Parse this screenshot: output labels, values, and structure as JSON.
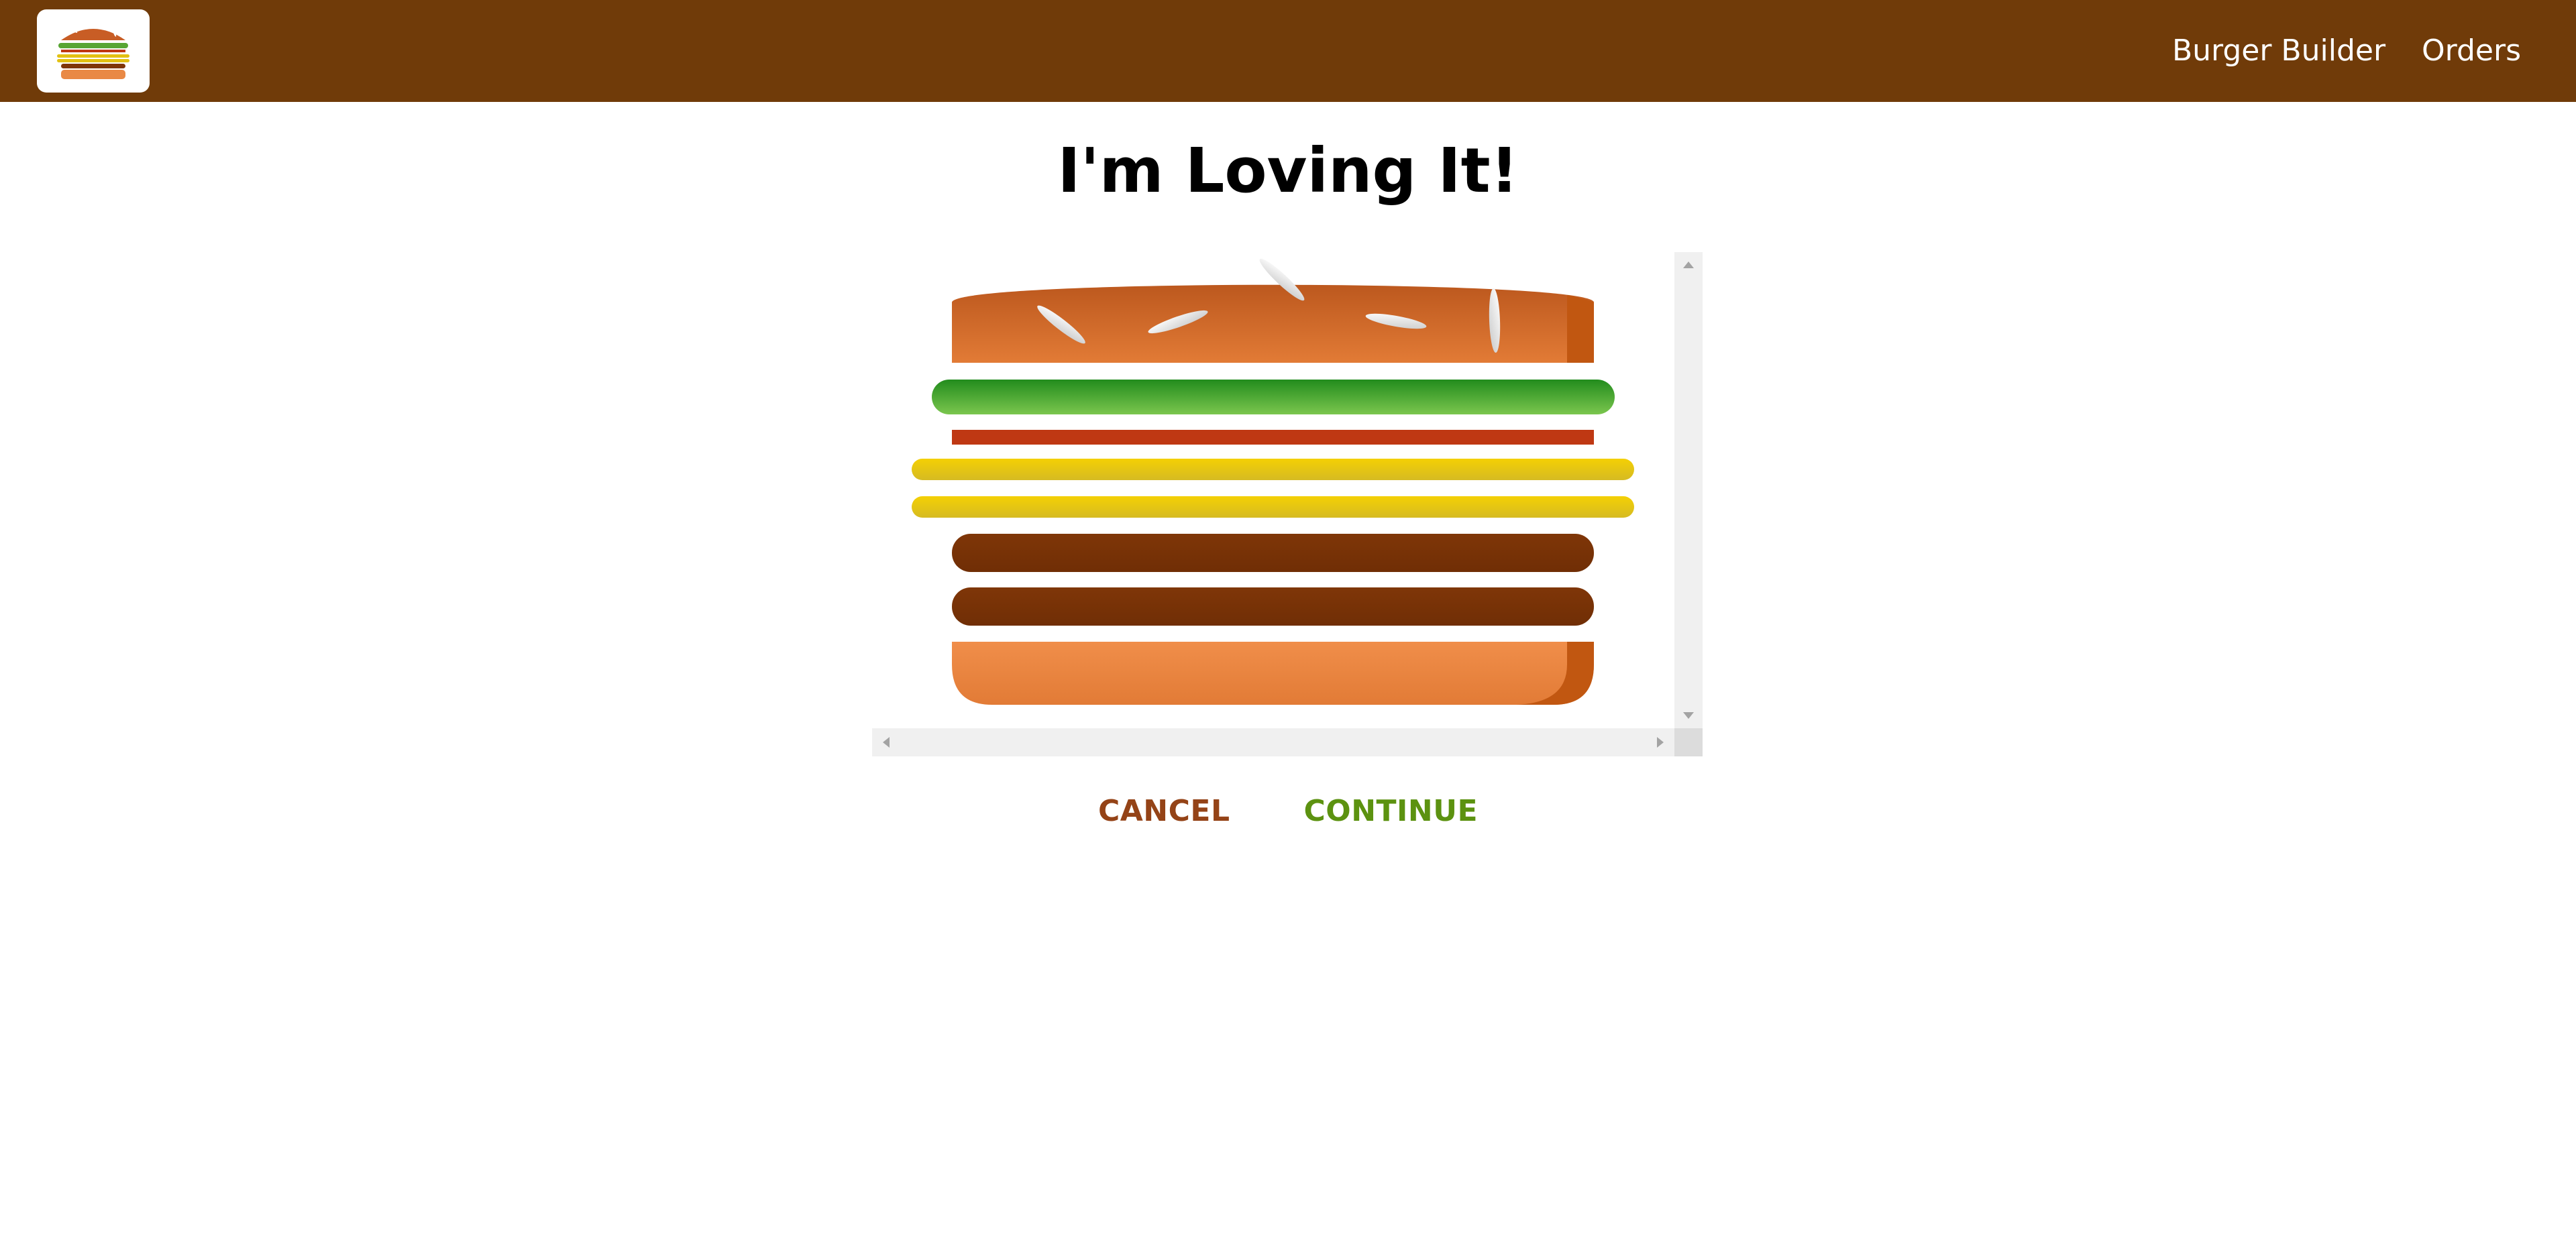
{
  "header": {
    "logo_name": "burger-logo",
    "nav": [
      {
        "label": "Burger Builder"
      },
      {
        "label": "Orders"
      }
    ]
  },
  "main": {
    "title": "I'm Loving It!",
    "burger": {
      "layers": [
        "bread-top",
        "salad",
        "bacon",
        "cheese",
        "cheese",
        "meat",
        "meat",
        "bread-bottom"
      ]
    },
    "actions": {
      "cancel": "CANCEL",
      "continue": "CONTINUE"
    }
  },
  "colors": {
    "toolbar": "#703B09",
    "cancel": "#944317",
    "continue": "#5C9210",
    "bread": "#E27B36",
    "salad": "#4A9E2F",
    "bacon": "#BF3813",
    "cheese": "#E2C113",
    "meat": "#7F3608"
  }
}
